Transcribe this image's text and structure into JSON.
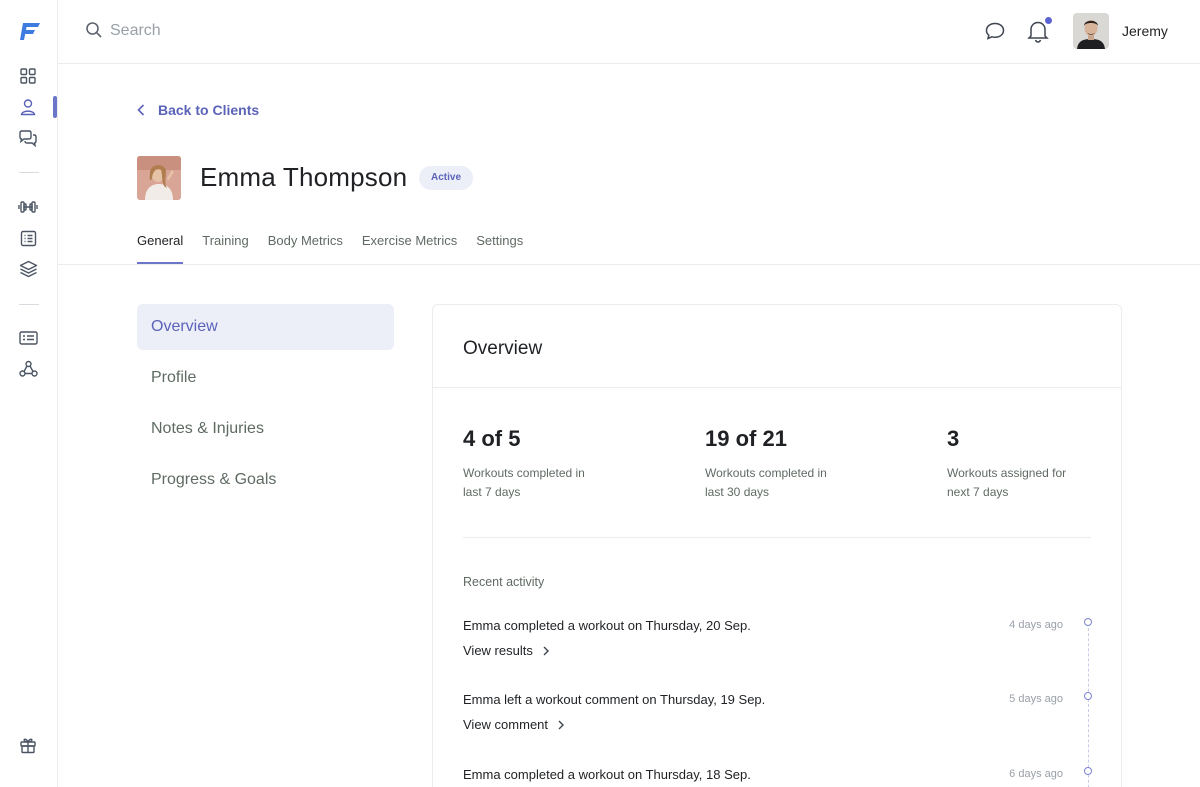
{
  "topbar": {
    "search_placeholder": "Search",
    "user_name": "Jeremy",
    "notification_dot_color": "#5b63d3"
  },
  "rail": {
    "icons": [
      "dashboard-icon",
      "user-icon",
      "chat-bubbles-icon",
      "dumbbell-icon",
      "list-icon",
      "layers-icon",
      "id-card-icon",
      "webhook-icon",
      "gift-icon"
    ],
    "active": "user-icon"
  },
  "header": {
    "back_label": "Back to Clients",
    "client_name": "Emma Thompson",
    "status": "Active"
  },
  "tabs": [
    {
      "label": "General",
      "active": true
    },
    {
      "label": "Training",
      "active": false
    },
    {
      "label": "Body Metrics",
      "active": false
    },
    {
      "label": "Exercise Metrics",
      "active": false
    },
    {
      "label": "Settings",
      "active": false
    }
  ],
  "subnav": [
    {
      "label": "Overview",
      "active": true
    },
    {
      "label": "Profile",
      "active": false
    },
    {
      "label": "Notes & Injuries",
      "active": false
    },
    {
      "label": "Progress & Goals",
      "active": false
    }
  ],
  "overview": {
    "title": "Overview",
    "stats": [
      {
        "value": "4 of 5",
        "caption_line1": "Workouts completed in",
        "caption_line2": "last 7 days"
      },
      {
        "value": "19 of 21",
        "caption_line1": "Workouts completed in",
        "caption_line2": "last 30 days"
      },
      {
        "value": "3",
        "caption_line1": "Workouts assigned for",
        "caption_line2": "next 7 days"
      }
    ],
    "recent_activity_title": "Recent activity",
    "activities": [
      {
        "text": "Emma completed a workout on Thursday, 20 Sep.",
        "link": "View results",
        "time": "4 days ago"
      },
      {
        "text": "Emma left a workout comment on Thursday, 19 Sep.",
        "link": "View comment",
        "time": "5 days ago"
      },
      {
        "text": "Emma completed a workout on Thursday, 18 Sep.",
        "link": "",
        "time": "6 days ago"
      }
    ]
  },
  "colors": {
    "accent": "#6b76c9",
    "accent_text": "#5b63b8",
    "accent_bg": "#eceef8"
  }
}
